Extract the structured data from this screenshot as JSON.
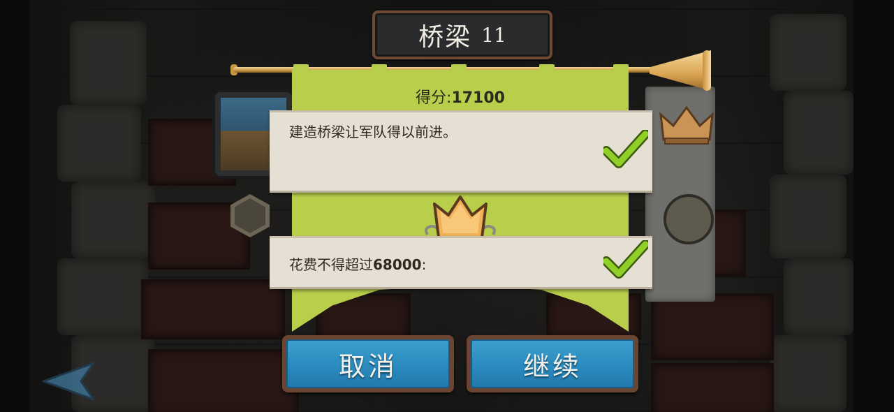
{
  "dialog": {
    "title": "桥梁",
    "level_number": "11",
    "score_label": "得分:",
    "score_value": "17100",
    "objectives": [
      {
        "text": "建造桥梁让军队得以前进。",
        "completed": true
      },
      {
        "text_prefix": "花费不得超过",
        "value": "68000",
        "text_suffix": ":",
        "completed": true
      }
    ]
  },
  "buttons": {
    "cancel_label": "取消",
    "continue_label": "继续"
  },
  "colors": {
    "banner_green": "#b9cf4b",
    "parchment": "#e6dfd3",
    "button_blue": "#2c8cc0",
    "check_green": "#7fbf20",
    "gold": "#d9a451"
  },
  "icons": [
    "trumpet-icon",
    "check-icon",
    "crown-medal-icon",
    "crown-icon",
    "back-arrow-icon"
  ]
}
